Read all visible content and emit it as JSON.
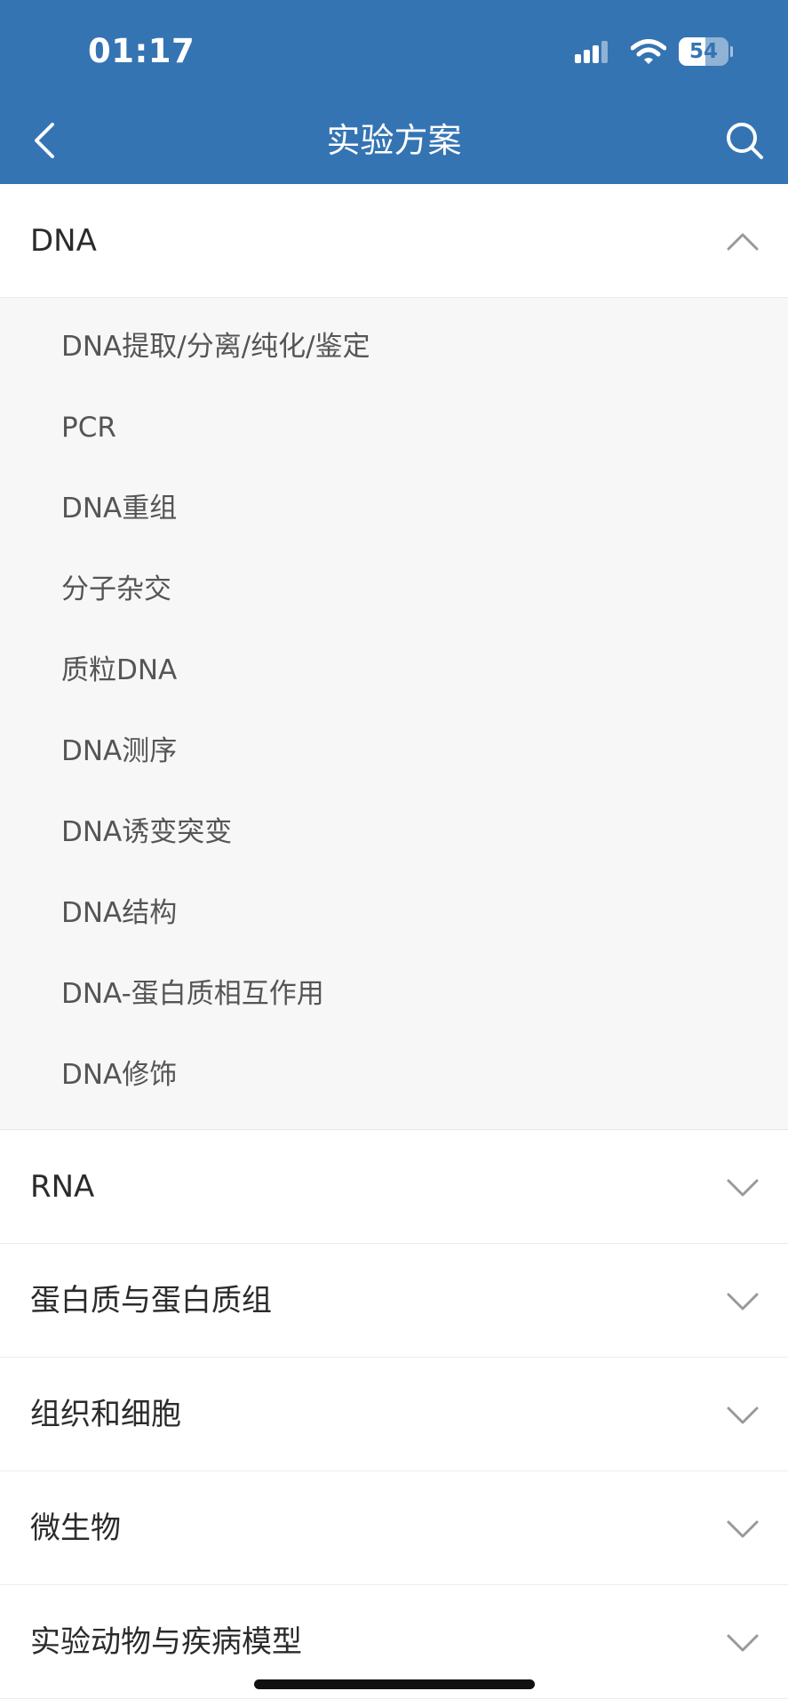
{
  "status_bar": {
    "time": "01:17",
    "battery_percent": 54,
    "battery_text": "54"
  },
  "header": {
    "title": "实验方案",
    "back_icon": "chevron-left-icon",
    "search_icon": "search-icon"
  },
  "sections": [
    {
      "label": "DNA",
      "expanded": true,
      "items": [
        "DNA提取/分离/纯化/鉴定",
        "PCR",
        "DNA重组",
        "分子杂交",
        "质粒DNA",
        "DNA测序",
        "DNA诱变突变",
        "DNA结构",
        "DNA-蛋白质相互作用",
        "DNA修饰"
      ]
    },
    {
      "label": "RNA",
      "expanded": false
    },
    {
      "label": "蛋白质与蛋白质组",
      "expanded": false
    },
    {
      "label": "组织和细胞",
      "expanded": false
    },
    {
      "label": "微生物",
      "expanded": false
    },
    {
      "label": "实验动物与疾病模型",
      "expanded": false
    }
  ],
  "colors": {
    "brand": "#3574b3",
    "submenu_bg": "#f7f7f7",
    "chevron": "#999999"
  }
}
